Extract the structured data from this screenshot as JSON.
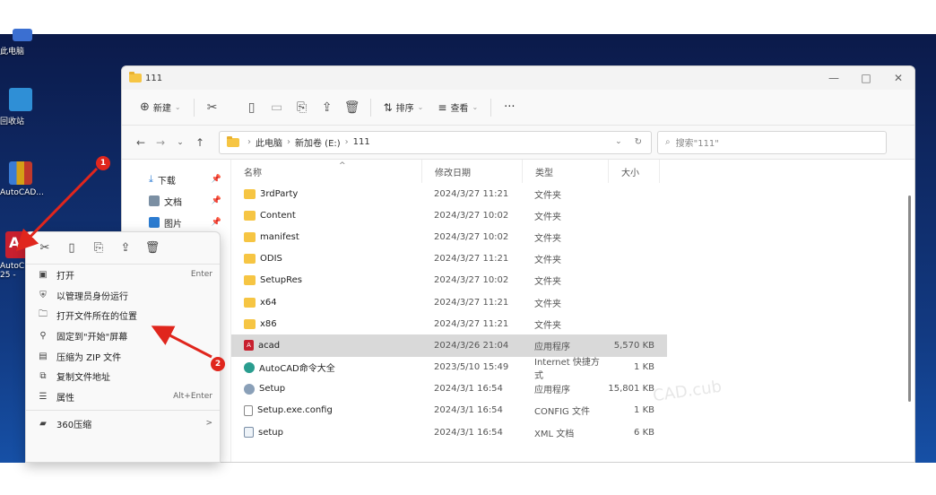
{
  "desktop": {
    "icons": [
      {
        "label": "此电脑",
        "color": "#3b6fd1"
      },
      {
        "label": "回收站",
        "color": "#2f8fd6"
      },
      {
        "label": "AutoCAD...",
        "color": "#2b7bd0"
      },
      {
        "label": "AutoC",
        "sub_label": "25 -",
        "color": "#c8202f"
      }
    ]
  },
  "explorer": {
    "title": "111",
    "window_controls": {
      "minimize": "—",
      "maximize": "□",
      "close": "✕"
    },
    "toolbar": {
      "new_label": "新建",
      "sort_label": "排序",
      "view_label": "查看",
      "more_label": "···"
    },
    "address": {
      "crumb_pc": "此电脑",
      "crumb_drive": "新加卷 (E:)",
      "crumb_folder": "111",
      "search_placeholder": "搜索\"111\""
    },
    "nav_items": [
      {
        "label": "下载",
        "icon_color": "#2d7cd3"
      },
      {
        "label": "文档",
        "icon_color": "#7b8fa3"
      },
      {
        "label": "图片",
        "icon_color": "#2b7bd0"
      }
    ],
    "columns": {
      "name": "名称",
      "date": "修改日期",
      "type": "类型",
      "size": "大小"
    },
    "files": [
      {
        "name": "3rdParty",
        "date": "2024/3/27 11:21",
        "type": "文件夹",
        "size": "",
        "icon": "folder"
      },
      {
        "name": "Content",
        "date": "2024/3/27 10:02",
        "type": "文件夹",
        "size": "",
        "icon": "folder"
      },
      {
        "name": "manifest",
        "date": "2024/3/27 10:02",
        "type": "文件夹",
        "size": "",
        "icon": "folder"
      },
      {
        "name": "ODIS",
        "date": "2024/3/27 11:21",
        "type": "文件夹",
        "size": "",
        "icon": "folder"
      },
      {
        "name": "SetupRes",
        "date": "2024/3/27 10:02",
        "type": "文件夹",
        "size": "",
        "icon": "folder"
      },
      {
        "name": "x64",
        "date": "2024/3/27 11:21",
        "type": "文件夹",
        "size": "",
        "icon": "folder"
      },
      {
        "name": "x86",
        "date": "2024/3/27 11:21",
        "type": "文件夹",
        "size": "",
        "icon": "folder"
      },
      {
        "name": "acad",
        "date": "2024/3/26 21:04",
        "type": "应用程序",
        "size": "5,570 KB",
        "icon": "app",
        "selected": true
      },
      {
        "name": "AutoCAD命令大全",
        "date": "2023/5/10 15:49",
        "type": "Internet 快捷方式",
        "size": "1 KB",
        "icon": "url"
      },
      {
        "name": "Setup",
        "date": "2024/3/1 16:54",
        "type": "应用程序",
        "size": "15,801 KB",
        "icon": "setup"
      },
      {
        "name": "Setup.exe.config",
        "date": "2024/3/1 16:54",
        "type": "CONFIG 文件",
        "size": "1 KB",
        "icon": "doc"
      },
      {
        "name": "setup",
        "date": "2024/3/1 16:54",
        "type": "XML 文档",
        "size": "6 KB",
        "icon": "xml"
      }
    ]
  },
  "context_menu": {
    "items": [
      {
        "label": "打开",
        "shortcut": "Enter",
        "icon": "open-icon",
        "glyph": "▣"
      },
      {
        "label": "以管理员身份运行",
        "shortcut": "",
        "icon": "admin-shield-icon",
        "glyph": "⛨"
      },
      {
        "label": "打开文件所在的位置",
        "shortcut": "",
        "icon": "folder-open-icon",
        "glyph": "🗀"
      },
      {
        "label": "固定到\"开始\"屏幕",
        "shortcut": "",
        "icon": "pin-icon",
        "glyph": "⚲"
      },
      {
        "label": "压缩为 ZIP 文件",
        "shortcut": "",
        "icon": "zip-icon",
        "glyph": "▤"
      },
      {
        "label": "复制文件地址",
        "shortcut": "",
        "icon": "copy-path-icon",
        "glyph": "⧉"
      },
      {
        "label": "属性",
        "shortcut": "Alt+Enter",
        "icon": "properties-icon",
        "glyph": "☰"
      },
      {
        "label": "360压缩",
        "shortcut": ">",
        "icon": "compress-360-icon",
        "glyph": "▰"
      }
    ]
  },
  "annotations": {
    "badge_1": "1",
    "badge_2": "2",
    "arrow_color": "#e0261d"
  },
  "watermark": "CAD.cub"
}
